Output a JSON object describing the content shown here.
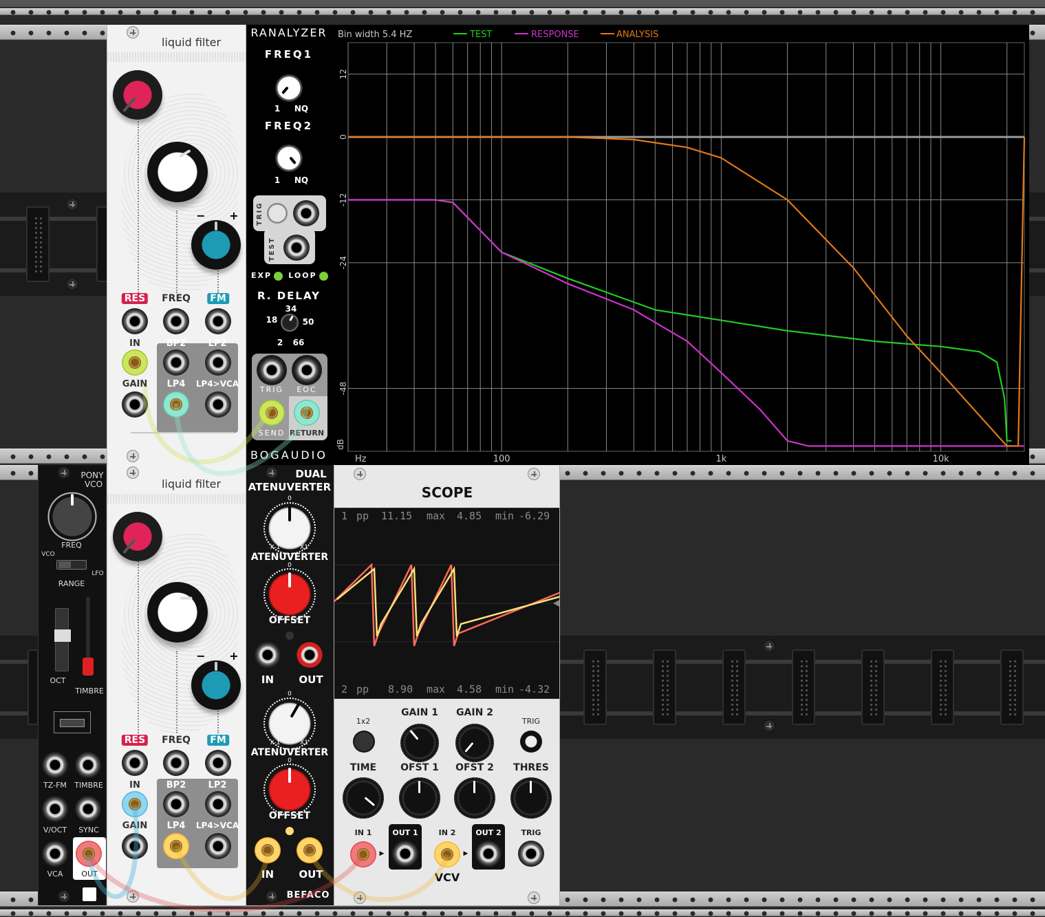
{
  "rack": {
    "accent_rail": "#bcbcbc"
  },
  "liquid_filter_top": {
    "title": "liquid filter",
    "labels": {
      "res": "RES",
      "freq": "FREQ",
      "fm": "FM",
      "in": "IN",
      "bp2": "BP2",
      "lp2": "LP2",
      "gain": "GAIN",
      "lp4": "LP4",
      "lp4vca": "LP4>VCA"
    },
    "fm_minus": "−",
    "fm_plus": "+"
  },
  "liquid_filter_bottom": {
    "title": "liquid filter",
    "labels": {
      "res": "RES",
      "freq": "FREQ",
      "fm": "FM",
      "in": "IN",
      "bp2": "BP2",
      "lp2": "LP2",
      "gain": "GAIN",
      "lp4": "LP4",
      "lp4vca": "LP4>VCA"
    },
    "fm_minus": "−",
    "fm_plus": "+"
  },
  "ranalyzer": {
    "title": "RANALYZER",
    "freq1": "FREQ1",
    "freq2": "FREQ2",
    "range_low": "1",
    "range_high": "NQ",
    "trig": "TRIG",
    "test": "TEST",
    "exp": "EXP",
    "loop": "LOOP",
    "rdelay": "R. DELAY",
    "delay_values": [
      "18",
      "34",
      "50",
      "2",
      "66"
    ],
    "trig_out": "TRIG",
    "eoc": "EOC",
    "send": "SEND",
    "return": "RETURN",
    "brand": "BOGAUDIO"
  },
  "analyzer_display": {
    "bin_width": "Bin width 5.4 HZ",
    "legend": [
      {
        "name": "TEST",
        "color": "#22cc22"
      },
      {
        "name": "RESPONSE",
        "color": "#cc33cc"
      },
      {
        "name": "ANALYSIS",
        "color": "#e07a1a"
      }
    ],
    "db_ticks": [
      "12",
      "0",
      "-12",
      "-24",
      "-48"
    ],
    "db_unit": "dB",
    "hz_unit": "Hz",
    "freq_ticks": [
      "100",
      "1k",
      "10k"
    ]
  },
  "chart_data": {
    "type": "line",
    "title": "",
    "xlabel": "Hz",
    "ylabel": "dB",
    "xscale": "log",
    "xlim": [
      20,
      24000
    ],
    "ylim": [
      -60,
      18
    ],
    "grid": true,
    "legend_placement": "top",
    "series": [
      {
        "name": "TEST",
        "color": "#22cc22",
        "x": [
          20,
          50,
          60,
          100,
          200,
          500,
          1000,
          2000,
          5000,
          10000,
          15000,
          18000,
          19500,
          20000,
          21000
        ],
        "y": [
          -12,
          -12,
          -12.5,
          -22,
          -27,
          -33,
          -35,
          -37,
          -39,
          -40,
          -41,
          -43,
          -50,
          -58,
          -58
        ]
      },
      {
        "name": "RESPONSE",
        "color": "#cc33cc",
        "x": [
          20,
          50,
          60,
          100,
          200,
          400,
          700,
          1000,
          1500,
          2000,
          2500,
          24000
        ],
        "y": [
          -12,
          -12,
          -12.5,
          -22,
          -28,
          -33,
          -39,
          -45,
          -52,
          -58,
          -59,
          -59
        ]
      },
      {
        "name": "ANALYSIS",
        "color": "#e07a1a",
        "x": [
          20,
          100,
          200,
          400,
          700,
          1000,
          2000,
          4000,
          7000,
          10000,
          20000,
          22500,
          24000
        ],
        "y": [
          0,
          0,
          0,
          -0.5,
          -2,
          -4,
          -12,
          -25,
          -38,
          -45,
          -59,
          -59,
          0
        ]
      }
    ]
  },
  "pony_vco": {
    "title_line1": "PONY",
    "title_line2": "VCO",
    "freq": "FREQ",
    "vco": "VCO",
    "lfo": "LFO",
    "range": "RANGE",
    "oct": "OCT",
    "timbre": "TIMBRE",
    "tzfm": "TZ-FM",
    "timbre_in": "TIMBRE",
    "voct": "V/OCT",
    "sync": "SYNC",
    "vca": "VCA",
    "out": "OUT"
  },
  "dual_atenuverter": {
    "title_line1": "DUAL",
    "title_line2": "ATENUVERTER",
    "atenuverter": "ATENUVERTER",
    "offset": "OFFSET",
    "x_minus": "X-1",
    "x_plus": "X1",
    "zero": "0",
    "in": "IN",
    "out": "OUT",
    "brand": "BEFACO"
  },
  "scope": {
    "title": "SCOPE",
    "ch1": {
      "num": "1",
      "pp_label": "pp",
      "pp": "11.15",
      "max_label": "max",
      "max": "4.85",
      "min_label": "min",
      "min": "-6.29"
    },
    "ch2": {
      "num": "2",
      "pp_label": "pp",
      "pp": "8.90",
      "max_label": "max",
      "max": "4.58",
      "min_label": "min",
      "min": "-4.32"
    },
    "mode": "1x2",
    "gain1": "GAIN 1",
    "gain2": "GAIN 2",
    "trig": "TRIG",
    "time": "TIME",
    "ofst1": "OFST 1",
    "ofst2": "OFST 2",
    "thres": "THRES",
    "in1": "IN 1",
    "out1": "OUT 1",
    "in2": "IN 2",
    "out2": "OUT 2",
    "trig_in": "TRIG",
    "brand": "VCV"
  }
}
